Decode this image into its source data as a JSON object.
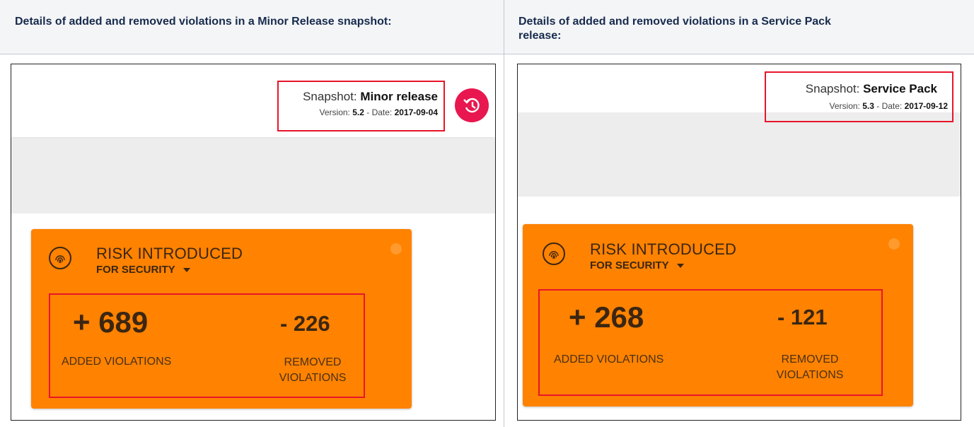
{
  "header": {
    "left": "Details of added and removed violations in a Minor Release snapshot:",
    "right_line1": "Details of added and removed violations in a Service Pack",
    "right_line2": "release:"
  },
  "panels": [
    {
      "snapshot_prefix": "Snapshot:",
      "snapshot_name": "Minor release",
      "version_prefix": "Version:",
      "version": "5.2",
      "date_prefix": "- Date:",
      "date": "2017-09-04",
      "card_title": "RISK INTRODUCED",
      "card_subtitle": "FOR SECURITY",
      "added": "+ 689",
      "removed": "- 226",
      "added_label": "ADDED VIOLATIONS",
      "removed_label_1": "REMOVED",
      "removed_label_2": "VIOLATIONS"
    },
    {
      "snapshot_prefix": "Snapshot:",
      "snapshot_name": "Service Pack",
      "version_prefix": "Version:",
      "version": "5.3",
      "date_prefix": "- Date:",
      "date": "2017-09-12",
      "card_title": "RISK INTRODUCED",
      "card_subtitle": "FOR SECURITY",
      "added": "+ 268",
      "removed": "- 121",
      "added_label": "ADDED VIOLATIONS",
      "removed_label_1": "REMOVED",
      "removed_label_2": "VIOLATIONS"
    }
  ],
  "colors": {
    "card": "#ff8200",
    "highlight": "#e8152b",
    "history_button": "#e8174f",
    "table_header": "#f4f5f7"
  },
  "icons": [
    "history-icon",
    "fingerprint-icon",
    "caret-down-icon",
    "gear-icon"
  ]
}
